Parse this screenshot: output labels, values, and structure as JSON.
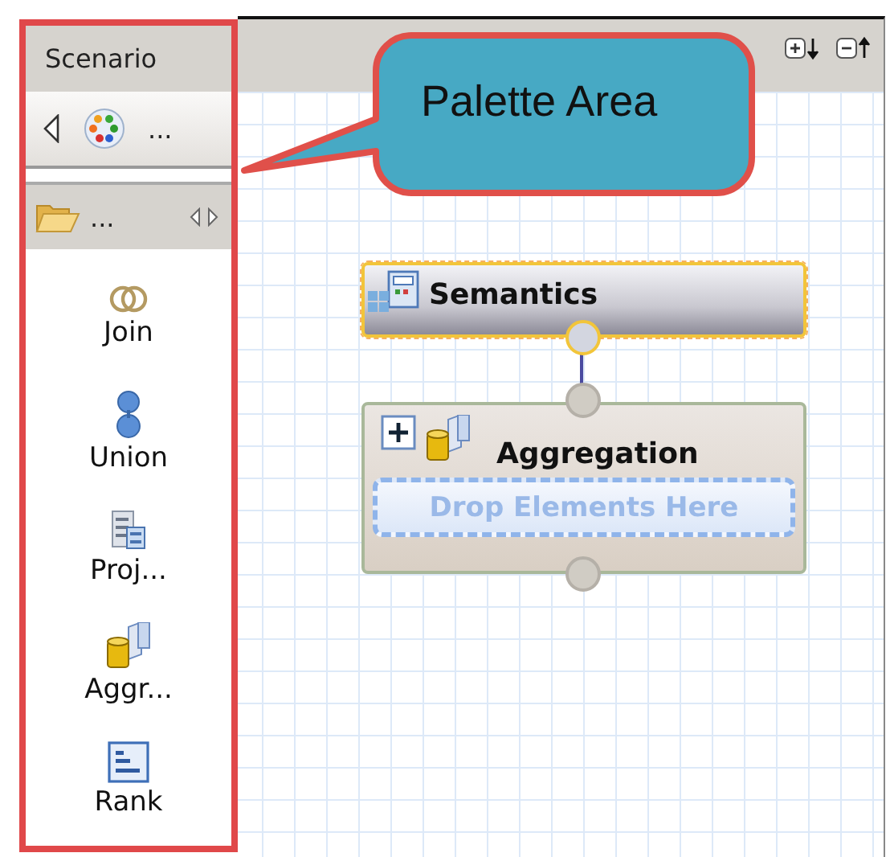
{
  "palette": {
    "title": "Scenario",
    "toolbar_overflow": "...",
    "drawer_label": "...",
    "tools": [
      {
        "kind": "join",
        "label": "Join"
      },
      {
        "kind": "union",
        "label": "Union"
      },
      {
        "kind": "projection",
        "label": "Proj..."
      },
      {
        "kind": "aggregation",
        "label": "Aggr..."
      },
      {
        "kind": "rank",
        "label": "Rank"
      }
    ]
  },
  "callout": {
    "text": "Palette Area"
  },
  "canvas": {
    "nodes": [
      {
        "kind": "semantics",
        "title": "Semantics",
        "selected": true
      },
      {
        "kind": "aggregation",
        "title": "Aggregation",
        "selected": false,
        "drop_hint": "Drop Elements Here"
      }
    ]
  }
}
